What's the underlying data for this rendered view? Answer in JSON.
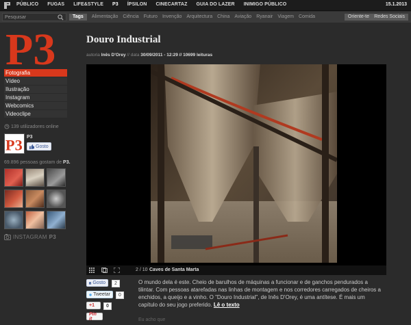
{
  "topnav": {
    "items": [
      "PÚBLICO",
      "FUGAS",
      "LIFE&STYLE",
      "P3",
      "ÍPSILON",
      "CINECARTAZ",
      "GUIA DO LAZER",
      "INIMIGO PÚBLICO"
    ],
    "date": "15.1.2013"
  },
  "search": {
    "placeholder": "Pesquisar"
  },
  "tags": {
    "label": "Tags",
    "items": [
      "Alimentação",
      "Ciência",
      "Futuro",
      "Invenção",
      "Arquitectura",
      "China",
      "Aviação",
      "Ryanair",
      "Viagem",
      "Comida"
    ]
  },
  "buttons": {
    "orient": "Oriente-te",
    "redes": "Redes Sociais"
  },
  "sidebar": {
    "logo_text": "P3",
    "menu": [
      "Fotografia",
      "Vídeo",
      "Ilustração",
      "Instagram",
      "Webcomics",
      "Videoclipe"
    ],
    "online": "139 utilizadores online",
    "fb_name": "P3",
    "fb_like": "Gosto",
    "likes_count": "69.896",
    "likes_text": "pessoas gostam de",
    "likes_brand": "P3.",
    "instagram_label": "INSTAGRAM",
    "instagram_brand": "P3"
  },
  "article": {
    "title": "Douro Industrial",
    "meta_author_prefix": "autoria",
    "meta_author": "Inês D'Orey",
    "meta_date_prefix": "// data",
    "meta_date": "30/09/2011 - 12:29",
    "meta_reads": "// 10699 leituras",
    "gallery_counter": "2 / 10",
    "gallery_caption": "Caves de Santa Marta",
    "body": "O mundo dela é este. Cheio de barulhos de máquinas a funcionar e de ganchos pendurados a tilintar. Com pessoas atarefadas nas linhas de montagem e nos corredores carregados de cheiros a enchidos, a queijo e a vinho. O \"Douro Industrial\", de Inês D'Orey, é uma antítese. É mais um capítulo do seu jogo preferido.",
    "read_more": "Lê o texto",
    "teaser": "Eu acho que"
  },
  "social": {
    "fb_label": "Gosto",
    "fb_count": "2",
    "tw_label": "Tweetar",
    "tw_count": "0",
    "gp_label": "+1",
    "gp_count": "0",
    "pin_label": "Pin it"
  },
  "colors": {
    "accent": "#d8381c",
    "background": "#2b2b2b"
  }
}
